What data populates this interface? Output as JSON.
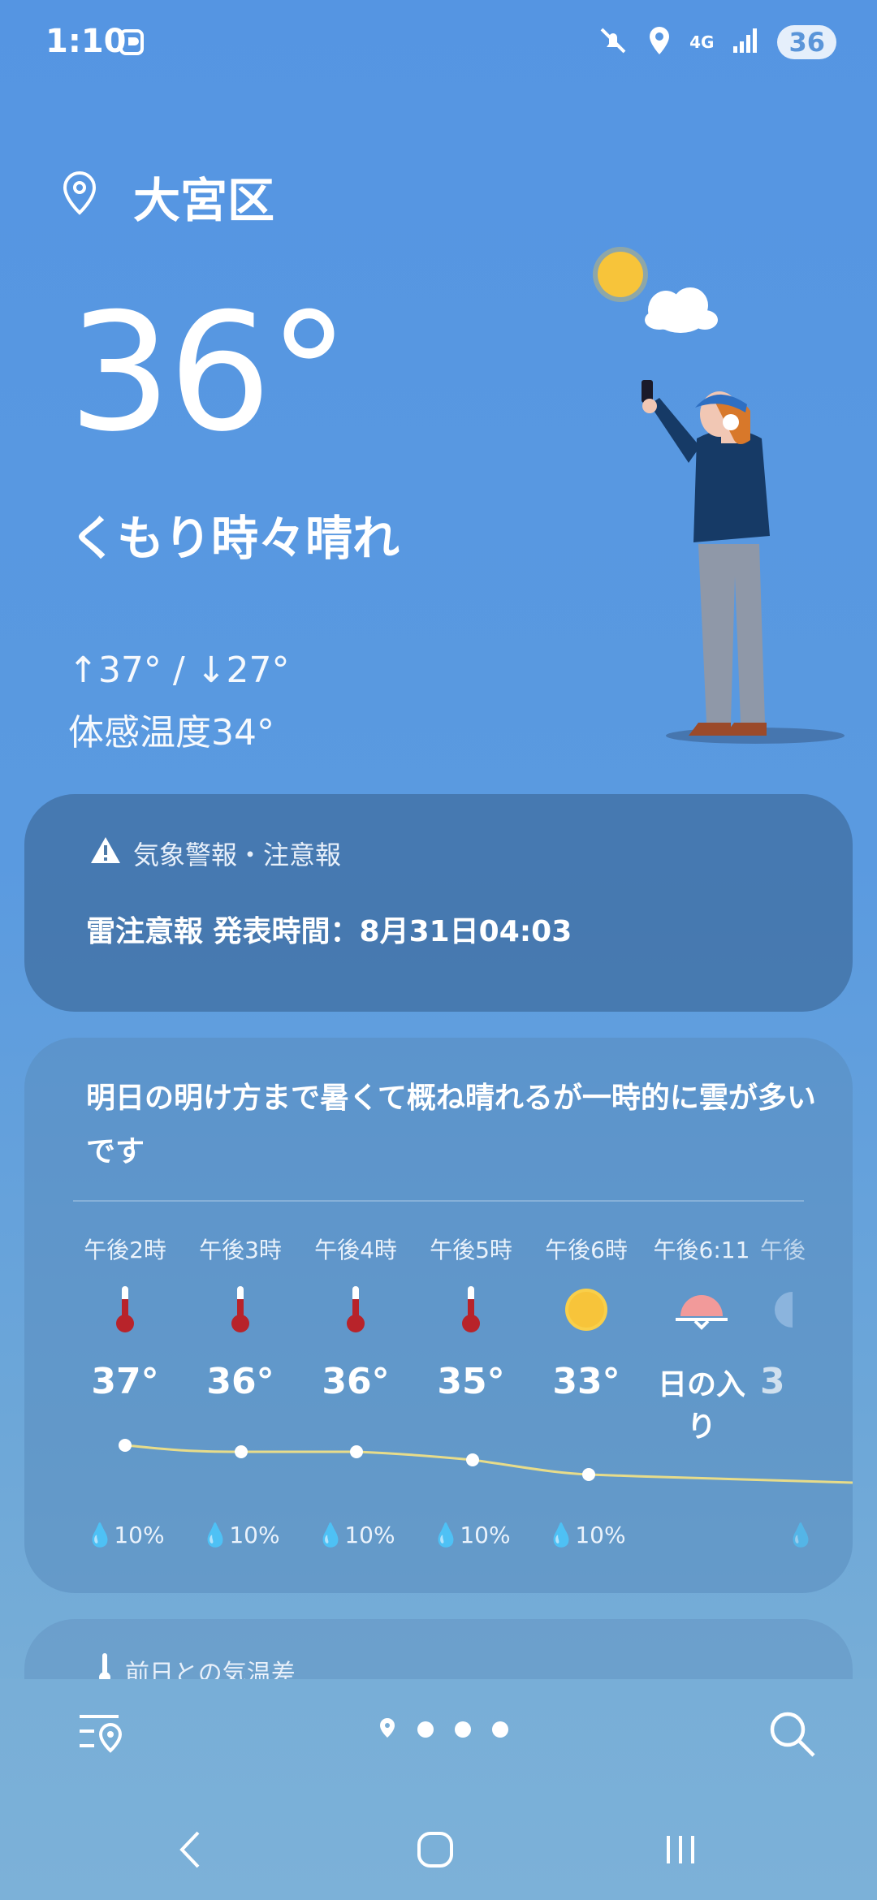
{
  "status_bar": {
    "time": "1:10",
    "network": "4G",
    "battery": "36",
    "icons": [
      "mute-icon",
      "location-icon",
      "4g-data-icon",
      "signal-icon",
      "battery-icon"
    ]
  },
  "location": {
    "name": "大宮区"
  },
  "current": {
    "temperature": "36°",
    "condition": "くもり時々晴れ",
    "high_low": "↑37° / ↓27°",
    "feels_like": "体感温度34°"
  },
  "alert": {
    "title": "気象警報・注意報",
    "body": "雷注意報 発表時間：8月31日04:03"
  },
  "forecast": {
    "summary": "明日の明け方まで暑くて概ね晴れるが一時的に雲が多いです",
    "hours": [
      {
        "time": "午後2時",
        "icon": "thermometer-hot-icon",
        "temp": "37°",
        "rain": "10%"
      },
      {
        "time": "午後3時",
        "icon": "thermometer-hot-icon",
        "temp": "36°",
        "rain": "10%"
      },
      {
        "time": "午後4時",
        "icon": "thermometer-hot-icon",
        "temp": "36°",
        "rain": "10%"
      },
      {
        "time": "午後5時",
        "icon": "thermometer-hot-icon",
        "temp": "35°",
        "rain": "10%"
      },
      {
        "time": "午後6時",
        "icon": "sun-icon",
        "temp": "33°",
        "rain": "10%"
      },
      {
        "time": "午後6:11",
        "icon": "sunset-icon",
        "temp": "日の入り",
        "rain": ""
      },
      {
        "time": "午後",
        "icon": "moon-icon",
        "temp": "3",
        "rain": ""
      }
    ]
  },
  "diff_card": {
    "title": "前日との気温差"
  },
  "bottom_bar": {
    "pages": 4,
    "current_page": 1
  },
  "colors": {
    "thermometer": "#b8232a",
    "sun": "#f8c73a",
    "sunset": "#f29a9a",
    "line": "#e7dc8a"
  }
}
